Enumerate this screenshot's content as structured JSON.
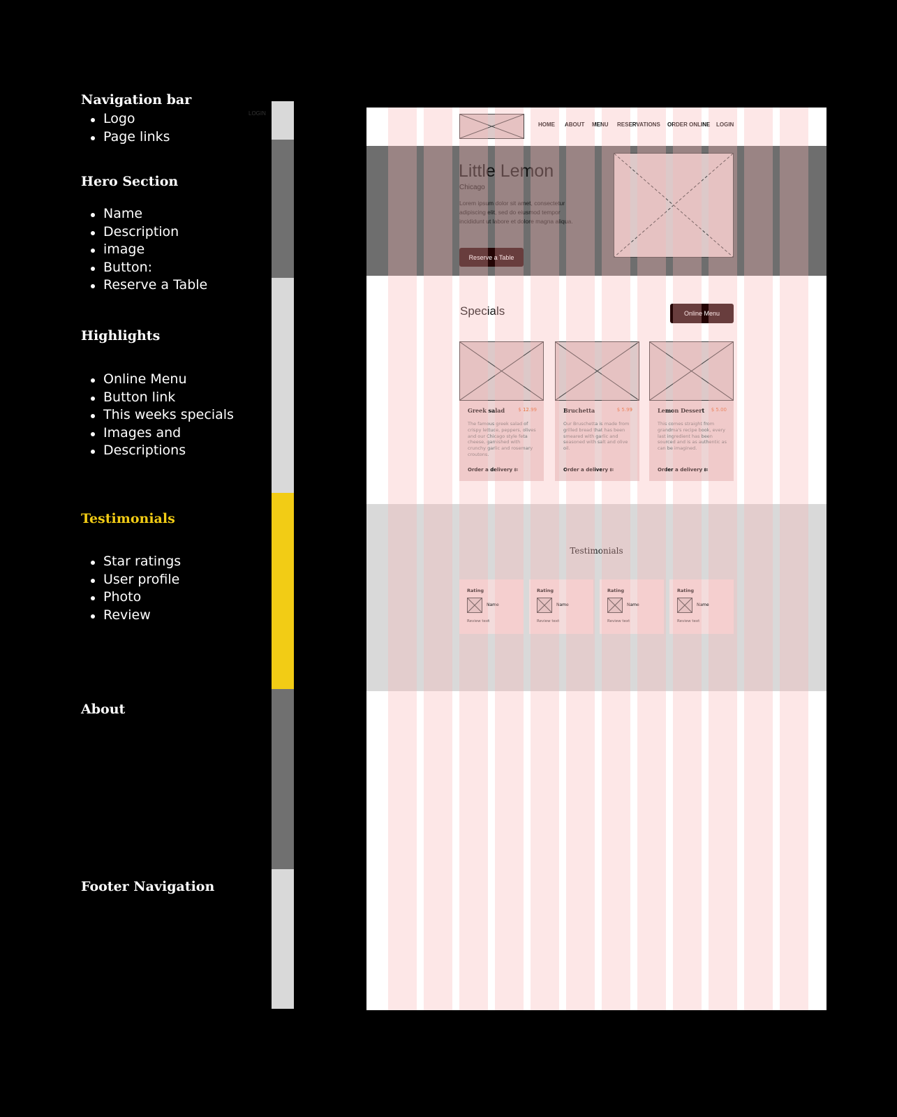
{
  "annotations": [
    {
      "title": "Navigation bar",
      "items": [
        "Logo",
        "Page links"
      ]
    },
    {
      "title": "Hero Section",
      "items": [
        "Name",
        "Description",
        "image",
        "Button:",
        "Reserve a Table"
      ]
    },
    {
      "title": "Highlights",
      "items": [
        "Online Menu",
        "Button link",
        "This weeks specials",
        "Images and",
        "Descriptions"
      ]
    },
    {
      "title": "Testimonials",
      "items": [
        "Star ratings",
        "User profile",
        "Photo",
        "Review"
      ]
    },
    {
      "title": "About",
      "items": []
    },
    {
      "title": "Footer Navigation",
      "items": []
    }
  ],
  "ghost_login": "LOGIN",
  "colors": {
    "highlight": "#f2cc15",
    "bar_light": "#d9d9d9",
    "bar_dark": "#707070",
    "hero_bg": "#6e6e6e",
    "button_dark": "#240505",
    "price": "#e8703a"
  },
  "nav": {
    "logo_icon": "image-placeholder-icon",
    "links": [
      "HOME",
      "ABOUT",
      "MENU",
      "RESERVATIONS",
      "ORDER ONLINE",
      "LOGIN"
    ]
  },
  "hero": {
    "name": "Little Lemon",
    "city": "Chicago",
    "description": "Lorem ipsum dolor sit amet, consectetur adipiscing elit, sed do eiusmod tempor incididunt ut labore et dolore magna aliqua.",
    "button": "Reserve a Table"
  },
  "specials": {
    "title": "Specials",
    "button": "Online Menu",
    "cards": [
      {
        "name": "Greek salad",
        "price": "$ 12.99",
        "description": "The famous greek salad of crispy lettuce, peppers, olives and our Chicago style feta cheese, garnished with crunchy garlic and rosemary croutons.",
        "order": "Order a delivery"
      },
      {
        "name": "Bruchetta",
        "price": "$ 5.99",
        "description": "Our Bruschetta is made from grilled bread that has been smeared with garlic and seasoned with salt and olive oil.",
        "order": "Order a delivery"
      },
      {
        "name": "Lemon Dessert",
        "price": "$ 5.00",
        "description": "This comes straight from grandma's recipe book, every last ingredient has been sourced and is as authentic as can be imagined.",
        "order": "Order a delivery"
      }
    ]
  },
  "testimonials": {
    "title": "Testimonials",
    "cards": [
      {
        "rating": "Rating",
        "name": "Name",
        "review": "Review text"
      },
      {
        "rating": "Rating",
        "name": "Name",
        "review": "Review text"
      },
      {
        "rating": "Rating",
        "name": "Name",
        "review": "Review text"
      },
      {
        "rating": "Rating",
        "name": "Name",
        "review": "Review text"
      }
    ]
  }
}
